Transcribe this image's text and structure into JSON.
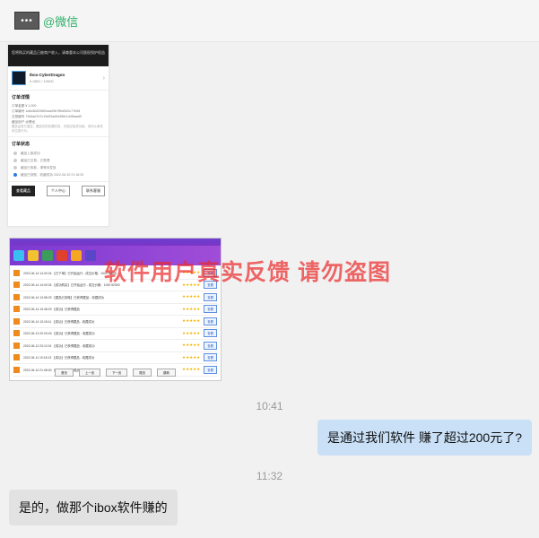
{
  "header": {
    "avatar_text": "•••",
    "title": "@微信"
  },
  "order_card": {
    "top_text": "您将购买的藏品已被商户收入，请尊重本公司版权保护权益",
    "user_name": "Ibox-CyberDragon",
    "user_sub": "# 2801 / 10000",
    "order_heading": "订单详情",
    "rows": [
      "订单金额   ¥ 1,000",
      "订单编号   1a6d3b6296f0eaa99b7ffbd0b0c77b98",
      "交易编号   73b6ad7d7c19d93ad9d4f6fc1d4fbaad9",
      "藏品用户   @蟹龙"
    ],
    "note": "藏品由官方鉴定，藏品仅供收藏欣赏，无相应投资功能，请勿从事任何交易行为。",
    "status_heading": "订单状态",
    "steps": [
      "藏品上架成功",
      "藏品已交易，已受理",
      "藏品已收款，请等待发放",
      "藏品已到账，收藏成功   2022-06-30 21:18:30"
    ],
    "buttons": [
      "查看藏品",
      "个人中心",
      "联系客服"
    ]
  },
  "software_card": {
    "rows": [
      "2022-06-14 14:00:34   【已下单】已开始运行 - 成交价格：1000 ¥2500",
      "2022-06-14 14:00:34   【成功购买】已开始运行 - 成交价格：1000 ¥2500",
      "2022-06-14 13:58:29   【藏品已到账】已获得藏品：收藏成功",
      "2022-06-14 13:48:29   【成功】已获得藏品",
      "2022-06-14 13:18:11   【成功】已获得藏品 - 收藏成功",
      "2022-06-13 20:03:43   【成功】已获得藏品 - 收藏成功",
      "2022-06-12 23:12:01   【成功】已获得藏品 - 收藏成功",
      "2022-06-11 19:18:13   【成功】已获得藏品 - 收藏成功",
      "2022-06-10 21:08:00   【成功】已获得藏品 - 收藏成功"
    ],
    "row_button": "查看",
    "footer_buttons": [
      "首页",
      "上一页",
      "下一页",
      "尾页",
      "跳转"
    ],
    "watermark": "软件用户真实反馈  请勿盗图"
  },
  "messages": [
    {
      "time": "10:41"
    },
    {
      "text": "是通过我们软件 赚了超过200元了?"
    },
    {
      "time": "11:32"
    },
    {
      "text": "是的，做那个ibox软件赚的"
    }
  ],
  "colors": {
    "accent": "#2bae67",
    "bubble_right": "#c9e0f7",
    "bubble_left": "#e2e2e2",
    "watermark": "#eb2828"
  }
}
